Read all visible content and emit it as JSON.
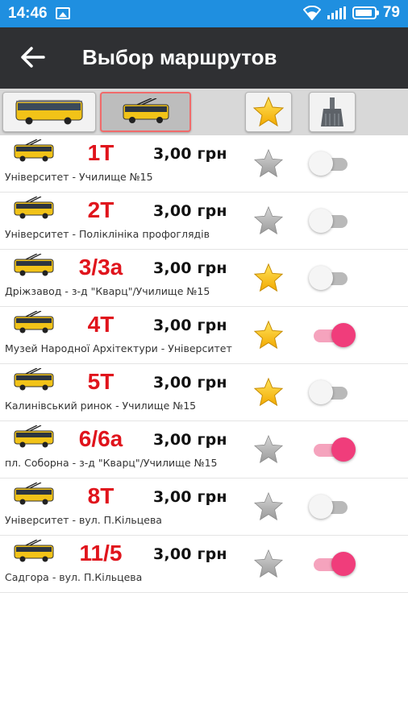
{
  "status_bar": {
    "time": "14:46",
    "battery_percent": "79",
    "icons": [
      "image-icon",
      "wifi-icon",
      "signal-icon",
      "battery-icon"
    ],
    "color": "#1f8fe0"
  },
  "app_bar": {
    "title": "Выбор маршрутов",
    "back_icon": "arrow-left-icon",
    "color": "#2f3033"
  },
  "tabs": [
    {
      "name": "bus",
      "icon": "bus-icon",
      "selected": false
    },
    {
      "name": "trolleybus",
      "icon": "trolleybus-icon",
      "selected": true
    },
    {
      "name": "favorites",
      "icon": "star-icon",
      "selected": false
    },
    {
      "name": "clear",
      "icon": "broom-icon",
      "selected": false
    }
  ],
  "colors": {
    "route_number": "#e0141c",
    "toggle_on": "#f03d7b",
    "star_favorite": "#f5b800",
    "star_inactive": "#b0b0b0"
  },
  "routes": [
    {
      "number": "1T",
      "price": "3,00 грн",
      "description": "Університет - Училище №15",
      "favorite": false,
      "enabled": false
    },
    {
      "number": "2T",
      "price": "3,00 грн",
      "description": "Університет - Поліклініка профоглядів",
      "favorite": false,
      "enabled": false
    },
    {
      "number": "3/3a",
      "price": "3,00 грн",
      "description": "Дріжзавод - з-д \"Кварц\"/Училище №15",
      "favorite": true,
      "enabled": false
    },
    {
      "number": "4T",
      "price": "3,00 грн",
      "description": "Музей Народної Архітектури - Університет",
      "favorite": true,
      "enabled": true
    },
    {
      "number": "5T",
      "price": "3,00 грн",
      "description": "Калинівський ринок - Училище №15",
      "favorite": true,
      "enabled": false
    },
    {
      "number": "6/6a",
      "price": "3,00 грн",
      "description": "пл. Соборна - з-д \"Кварц\"/Училище №15",
      "favorite": false,
      "enabled": true
    },
    {
      "number": "8T",
      "price": "3,00 грн",
      "description": "Університет - вул. П.Кільцева",
      "favorite": false,
      "enabled": false
    },
    {
      "number": "11/5",
      "price": "3,00 грн",
      "description": "Садгора - вул. П.Кільцева",
      "favorite": false,
      "enabled": true
    }
  ]
}
